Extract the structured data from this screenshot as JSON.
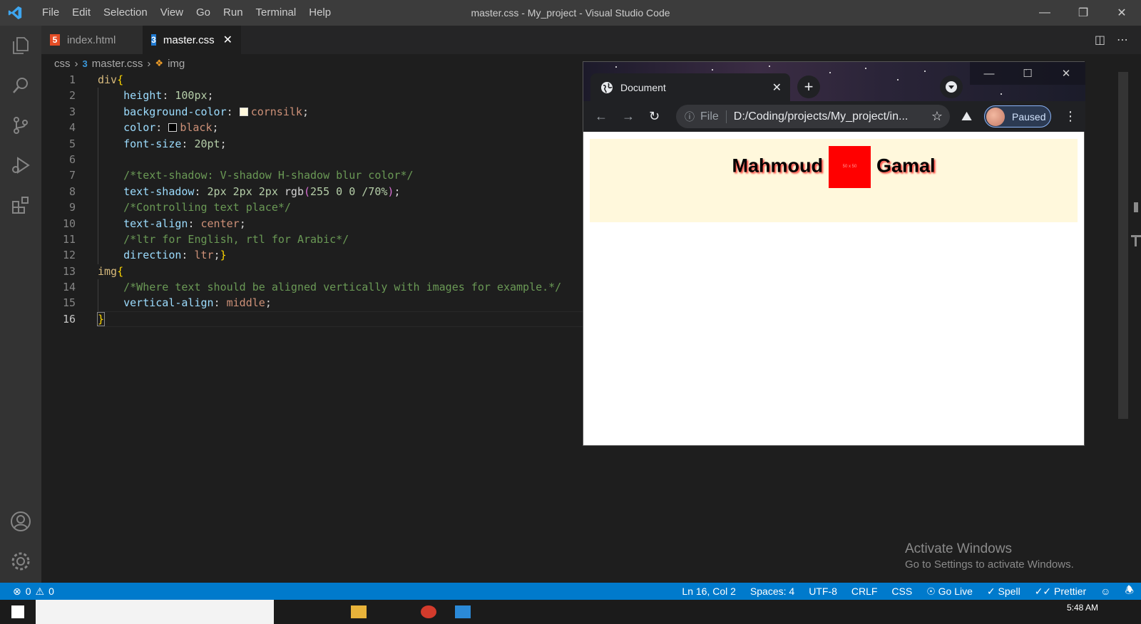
{
  "titlebar": {
    "menu": [
      "File",
      "Edit",
      "Selection",
      "View",
      "Go",
      "Run",
      "Terminal",
      "Help"
    ],
    "window_title": "master.css - My_project - Visual Studio Code"
  },
  "tabs": [
    {
      "label": "index.html",
      "icon": "html5-icon",
      "icon_glyph": "5"
    },
    {
      "label": "master.css",
      "icon": "css3-icon",
      "icon_glyph": "3"
    }
  ],
  "breadcrumb": {
    "folder": "css",
    "file": "master.css",
    "symbol": "img"
  },
  "code": {
    "l1": "div",
    "l2_prop": "height",
    "l2_val": "100px",
    "l3_prop": "background-color",
    "l3_val": "cornsilk",
    "l4_prop": "color",
    "l4_val": "black",
    "l5_prop": "font-size",
    "l5_val": "20pt",
    "l7": "/*text-shadow: V-shadow H-shadow blur color*/",
    "l8_prop": "text-shadow",
    "l8_nums": "2px 2px 2px",
    "l8_fn": "rgb",
    "l8_args": "255 0 0 /70%",
    "l9": "/*Controlling text place*/",
    "l10_prop": "text-align",
    "l10_val": "center",
    "l11": "/*ltr for English, rtl for Arabic*/",
    "l12_prop": "direction",
    "l12_val": "ltr",
    "l13": "img",
    "l14": "/*Where text should be aligned vertically with images for example.*/",
    "l15_prop": "vertical-align",
    "l15_val": "middle"
  },
  "colors": {
    "cornsilk": "#fff8dc",
    "black": "#000000",
    "statusbar": "#007acc"
  },
  "browser": {
    "tab_title": "Document",
    "file_label": "File",
    "url": "D:/Coding/projects/My_project/in...",
    "profile_status": "Paused",
    "page_text_left": "Mahmoud",
    "image_label": "50 x 50",
    "page_text_right": "Gamal"
  },
  "watermark": {
    "title": "Activate Windows",
    "subtitle": "Go to Settings to activate Windows."
  },
  "status": {
    "errors": "0",
    "warnings": "0",
    "position": "Ln 16, Col 2",
    "spaces": "Spaces: 4",
    "encoding": "UTF-8",
    "eol": "CRLF",
    "language": "CSS",
    "golive": "Go Live",
    "spell": "Spell",
    "prettier": "Prettier"
  },
  "taskbar": {
    "time": "5:48 AM"
  }
}
